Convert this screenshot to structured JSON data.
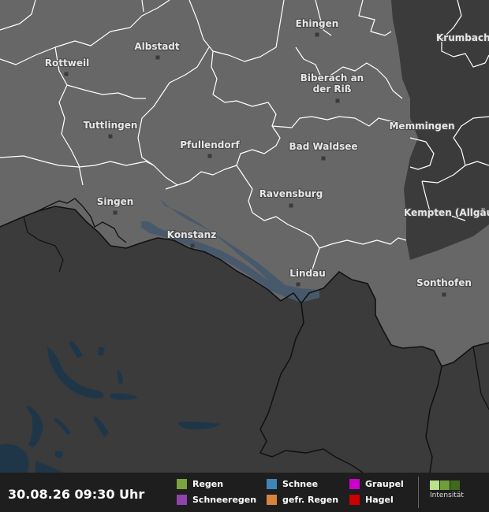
{
  "map": {
    "cities": [
      {
        "id": "ehingen",
        "name": "Ehingen"
      },
      {
        "id": "krumbach",
        "name": "Krumbach"
      },
      {
        "id": "albstadt",
        "name": "Albstadt"
      },
      {
        "id": "rottweil",
        "name": "Rottweil"
      },
      {
        "id": "biberach",
        "name": "Biberach an",
        "name2": "der Riß"
      },
      {
        "id": "tuttlingen",
        "name": "Tuttlingen"
      },
      {
        "id": "memmingen",
        "name": "Memmingen"
      },
      {
        "id": "pfullendorf",
        "name": "Pfullendorf"
      },
      {
        "id": "bad-waldsee",
        "name": "Bad Waldsee"
      },
      {
        "id": "singen",
        "name": "Singen"
      },
      {
        "id": "ravensburg",
        "name": "Ravensburg"
      },
      {
        "id": "kempten",
        "name": "Kempten (Allgäu)"
      },
      {
        "id": "konstanz",
        "name": "Konstanz"
      },
      {
        "id": "lindau",
        "name": "Lindau"
      },
      {
        "id": "sonthofen",
        "name": "Sonthofen"
      }
    ],
    "colors": {
      "land_inside": "#676767",
      "land_outside": "#3b3b3b",
      "lake": "#48596b",
      "lake_outside": "#1f3648",
      "border_region": "#ffffff",
      "border_country": "#111111"
    }
  },
  "legend": {
    "timestamp": "30.08.26 09:30 Uhr",
    "items": [
      {
        "label": "Regen",
        "color": "#7aa23f"
      },
      {
        "label": "Schneeregen",
        "color": "#8e44ad"
      },
      {
        "label": "Schnee",
        "color": "#3f86b8"
      },
      {
        "label": "gefr. Regen",
        "color": "#d8843d"
      },
      {
        "label": "Graupel",
        "color": "#cc00cc"
      },
      {
        "label": "Hagel",
        "color": "#cc0000"
      }
    ],
    "intensity_label": "Intensität",
    "intensity_colors": [
      "#b9e08c",
      "#6f9e3a",
      "#3d6a1f"
    ]
  }
}
